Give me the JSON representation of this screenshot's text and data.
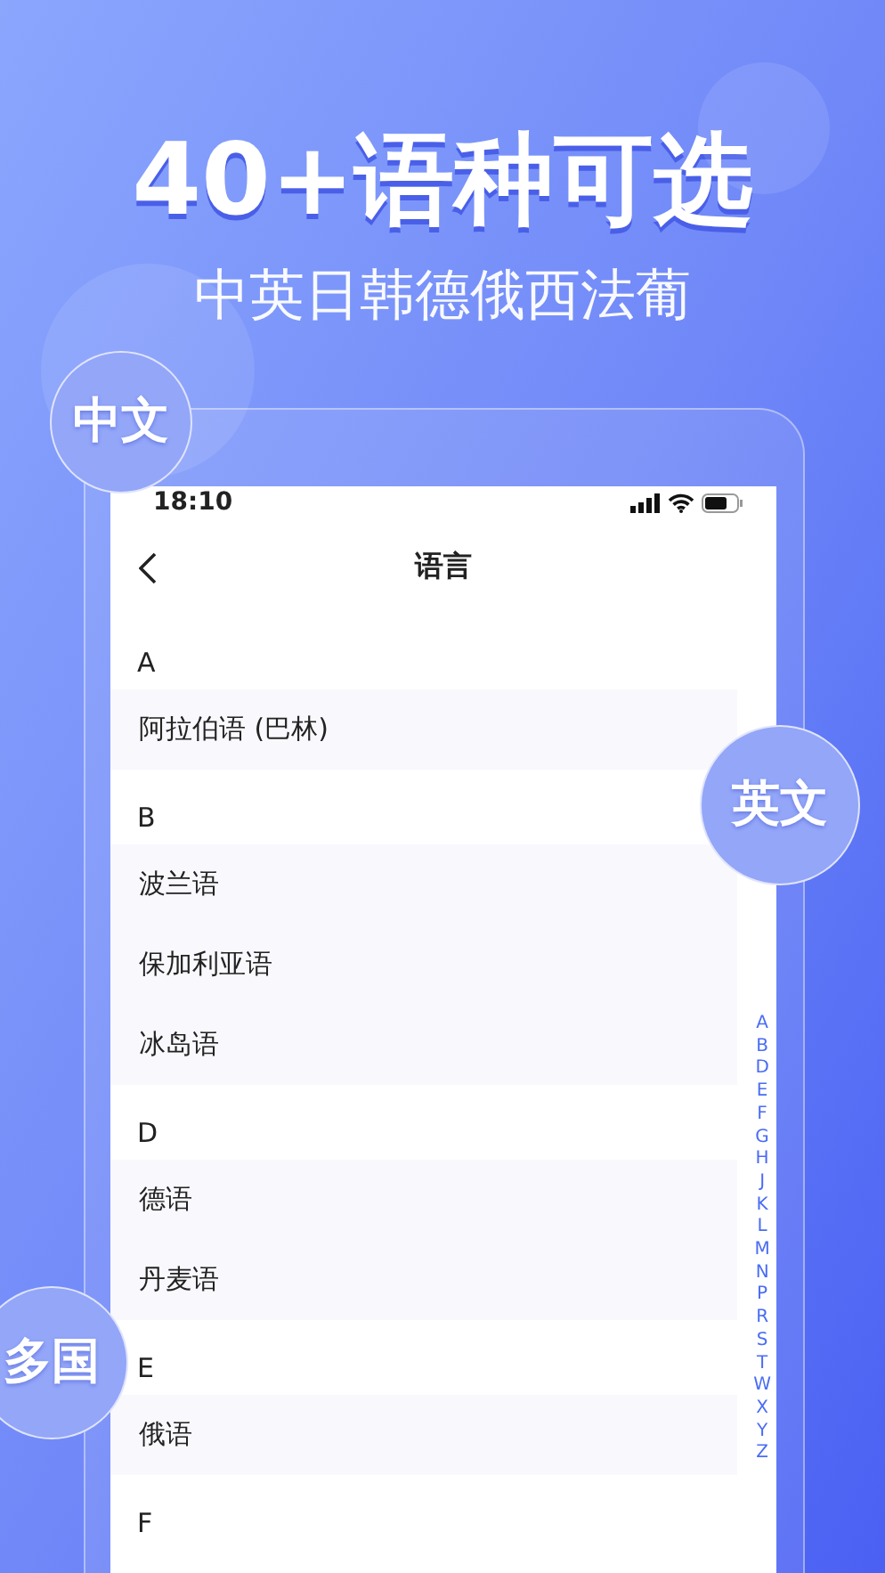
{
  "headline": "40+语种可选",
  "subheadline": "中英日韩德俄西法葡",
  "bubbles": [
    "中文",
    "英文",
    "多国"
  ],
  "status_bar": {
    "time": "18:10"
  },
  "nav": {
    "title": "语言"
  },
  "sections": [
    {
      "letter": "A",
      "items": [
        "阿拉伯语 (巴林)"
      ]
    },
    {
      "letter": "B",
      "items": [
        "波兰语",
        "保加利亚语",
        "冰岛语"
      ]
    },
    {
      "letter": "D",
      "items": [
        "德语",
        "丹麦语"
      ]
    },
    {
      "letter": "E",
      "items": [
        "俄语"
      ]
    },
    {
      "letter": "F"
    }
  ],
  "index": [
    "A",
    "B",
    "D",
    "E",
    "F",
    "G",
    "H",
    "J",
    "K",
    "L",
    "M",
    "N",
    "P",
    "R",
    "S",
    "T",
    "W",
    "X",
    "Y",
    "Z"
  ]
}
